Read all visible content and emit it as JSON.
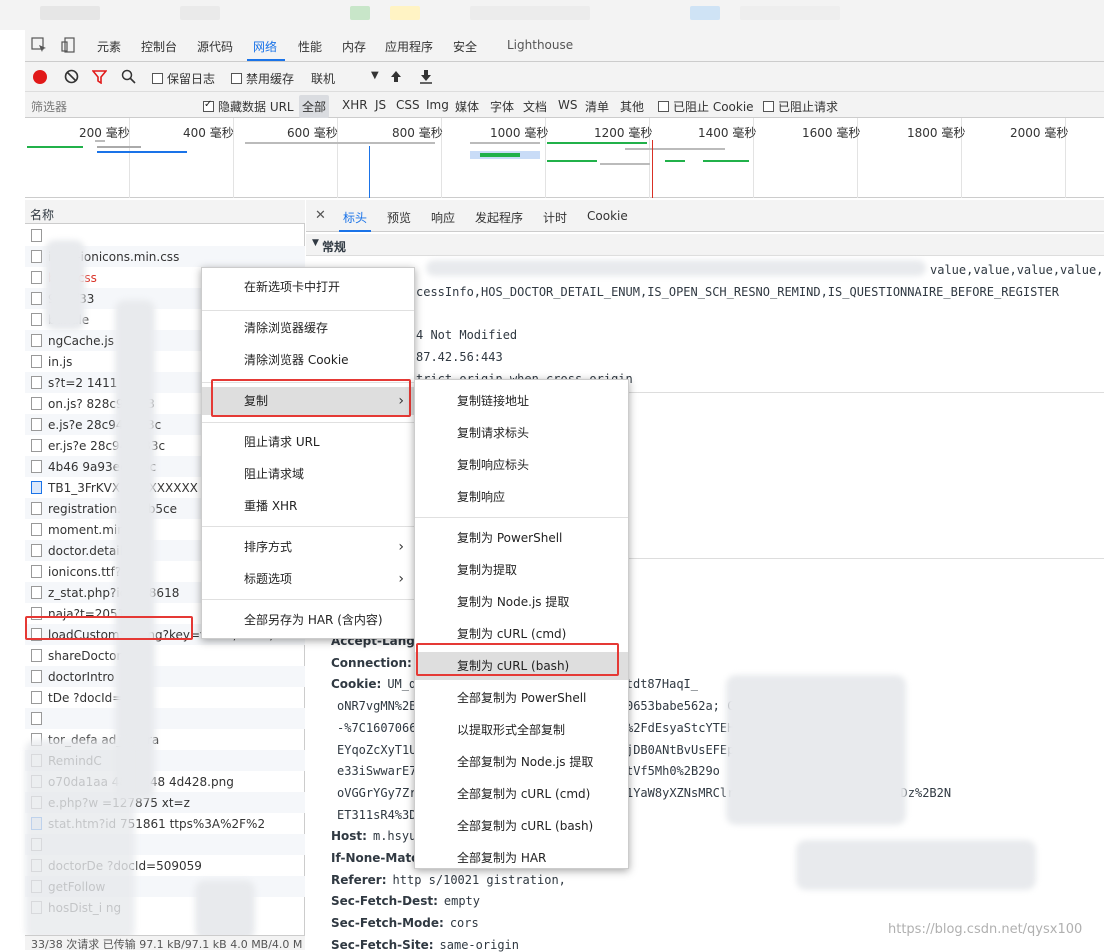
{
  "devtools": {
    "main_tabs": [
      "元素",
      "控制台",
      "源代码",
      "网络",
      "性能",
      "内存",
      "应用程序",
      "安全",
      "Lighthouse"
    ],
    "active_tab": "网络"
  },
  "toolbar": {
    "preserve_log": "保留日志",
    "disable_cache": "禁用缓存",
    "throttle": "联机"
  },
  "filter": {
    "placeholder": "筛选器",
    "hide_data_urls": "隐藏数据 URL",
    "types": [
      "全部",
      "XHR",
      "JS",
      "CSS",
      "Img",
      "媒体",
      "字体",
      "文档",
      "WS",
      "清单",
      "其他"
    ],
    "blocked_cookies": "已阻止 Cookie",
    "blocked_requests": "已阻止请求"
  },
  "timeline": {
    "ticks": [
      "200 毫秒",
      "400 毫秒",
      "600 毫秒",
      "800 毫秒",
      "1000 毫秒",
      "1200 毫秒",
      "1400 毫秒",
      "1600 毫秒",
      "1800 毫秒",
      "2000 毫秒"
    ]
  },
  "request_list": {
    "header": "名称",
    "rows": [
      "",
      "ionic-ionicons.min.css",
      "blue.css",
      "94bff33",
      "bundle",
      "ngCache.js",
      "in.js",
      "s?t=2 1411",
      "on.js?   828c94bff3",
      "e.js?e   28c94bff33c",
      "er.js?e   28c94bff33c",
      "4b46   9a93ec72bc",
      "TB1_3FrKVX   XXXXXXXXX",
      "registration.   7dbb5ce",
      "moment.min.   js",
      "doctor.details",
      "ionicons.ttf?v=",
      "z_stat.php?id=1   8618",
      "naja?t=2051",
      "loadCustomSetting?key=value,value,value",
      "shareDoctor",
      "doctorIntro",
      "tDe   ?docId=509",
      "",
      "tor_defa   ad_portra",
      "RemindC",
      "o70da1aa   4825148   4d428.png",
      "e.php?w   =127875   xt=z",
      "stat.htm?id   751861   ttps%3A%2F%2",
      "",
      "doctorDe   ?docId=509059",
      "getFollow",
      "hosDist_i   ng"
    ],
    "status": "33/38 次请求  已传输 97.1 kB/97.1 kB  4.0 MB/4.0 M"
  },
  "detail": {
    "tabs": [
      "标头",
      "预览",
      "响应",
      "发起程序",
      "计时",
      "Cookie"
    ],
    "active_tab": "标头",
    "section_general": "常规",
    "general_lines": [
      "value,value,value,value,va",
      "cessInfo,HOS_DOCTOR_DETAIL_ENUM,IS_OPEN_SCH_RESNO_REMIND,IS_QUESTIONNAIRE_BEFORE_REGISTER",
      "4 Not Modified",
      "87.42.56:443",
      "trict-origin-when-cross-origin"
    ],
    "request_headers": [
      {
        "name": "Accept-Langua",
        "value": ";q=0.7,en-US;q=0.6"
      },
      {
        "name": "Connection:",
        "value": "k"
      },
      {
        "name": "Cookie:",
        "value": "UM_di   6e5b4-7f67   sid=s%3AYzP4TzZNtdt87HaqI_"
      },
      {
        "name": "",
        "value": "oNR7vgMN%2BNc   0f631607   9598c857c1e8e0c060653babe562a; CNZZDATA1278"
      },
      {
        "name": "",
        "value": "-%7C16070664   EEEEEEpEQz0yFZ6VTSX   pCjYFET%2FdEsyaStcYTEH"
      },
      {
        "name": "",
        "value": "EYqoZcXyT1UJ   iYDLbGdViaVfZV2hx%2FNyR0Y   7jDB0ANtBvUsEFEp311syaSt311111%FA%2Fi"
      },
      {
        "name": "",
        "value": "e33iSwwarE7E   UYEabb1dCwUQrjDt9y   BPweG6UVtVf5Mh0%2B29o"
      },
      {
        "name": "",
        "value": "oVGGrYGy7Zr0   VbiiqaWw7rjZBNGSt%2FqudrLoW1YaW8yXZNsMRClricKoSPQsc%2Fo8G608B1Os4Dz%2B2N"
      },
      {
        "name": "",
        "value": "ET311sR4%3D"
      },
      {
        "name": "Host:",
        "value": "m.hsyun"
      },
      {
        "name": "If-None-Match",
        "value": ""
      },
      {
        "name": "Referer:",
        "value": "http   s/10021   gistration,"
      },
      {
        "name": "Sec-Fetch-Dest:",
        "value": "empty"
      },
      {
        "name": "Sec-Fetch-Mode:",
        "value": "cors"
      },
      {
        "name": "Sec-Fetch-Site:",
        "value": "same-origin"
      }
    ]
  },
  "context_menu": {
    "items": [
      "在新选项卡中打开",
      "清除浏览器缓存",
      "清除浏览器 Cookie",
      "复制",
      "阻止请求 URL",
      "阻止请求域",
      "重播 XHR",
      "排序方式",
      "标题选项",
      "全部另存为 HAR (含内容)"
    ]
  },
  "copy_submenu": {
    "items": [
      "复制链接地址",
      "复制请求标头",
      "复制响应标头",
      "复制响应",
      "复制为 PowerShell",
      "复制为提取",
      "复制为 Node.js 提取",
      "复制为 cURL (cmd)",
      "复制为 cURL (bash)",
      "全部复制为 PowerShell",
      "以提取形式全部复制",
      "全部复制为 Node.js 提取",
      "全部复制为 cURL (cmd)",
      "全部复制为 cURL (bash)",
      "全部复制为 HAR"
    ]
  },
  "watermark": "https://blog.csdn.net/qysx100",
  "colors": {
    "accent": "#1a73e8",
    "highlight": "#e53935",
    "record": "#e11919",
    "bar_green": "#21b14a"
  }
}
